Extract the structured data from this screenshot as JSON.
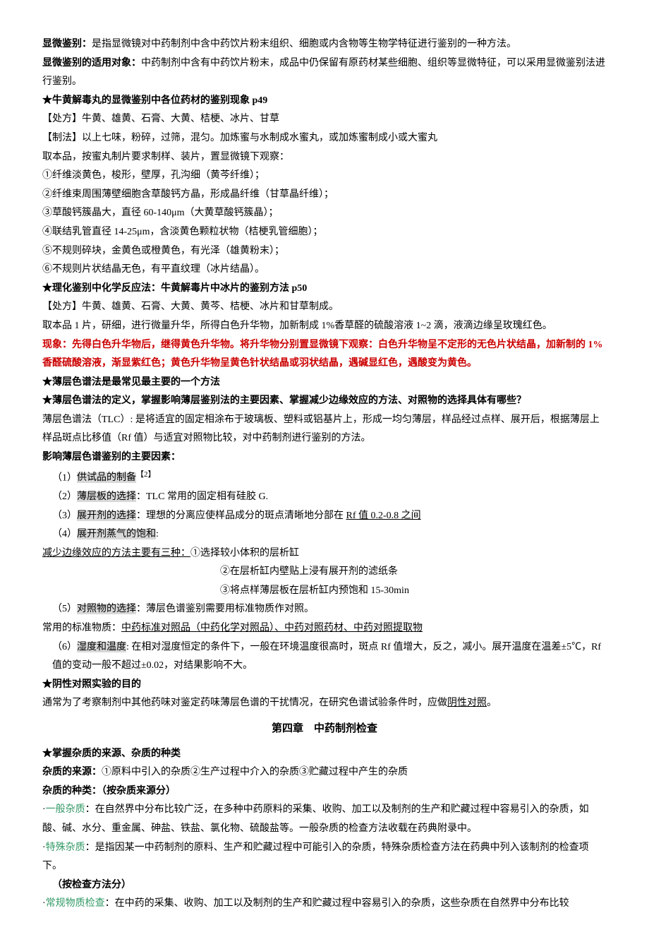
{
  "p01a": "显微鉴别：",
  "p01b": "是指显微镜对中药制剂中含中药饮片粉末组织、细胞或内含物等生物学特征进行鉴别的一种方法。",
  "p02a": "显微鉴别的适用对象：",
  "p02b": "中药制剂中含有中药饮片粉末，成品中仍保留有原药材某些细胞、组织等显微特征，可以采用显微鉴别法进行鉴别。",
  "p03": "★牛黄解毒丸的显微鉴别中各位药材的鉴别现象 p49",
  "p04": "【处方】牛黄、雄黄、石膏、大黄、桔梗、冰片、甘草",
  "p05": "【制法】以上七味，粉碎，过筛，混匀。加炼蜜与水制成水蜜丸，或加炼蜜制成小或大蜜丸",
  "p06": "取本品，按蜜丸制片要求制样、装片，置显微镜下观察：",
  "p07": "①纤维淡黄色，梭形，壁厚，孔沟细（黄芩纤维）；",
  "p08": "②纤维束周围薄壁细胞含草酸钙方晶，形成晶纤维（甘草晶纤维）；",
  "p09": "③草酸钙簇晶大，直径 60-140μm（大黄草酸钙簇晶）；",
  "p10": "④联结乳管直径 14-25μm，含淡黄色颗粒状物（桔梗乳管细胞）；",
  "p11": "⑤不规则碎块，金黄色或橙黄色，有光泽（雄黄粉末）；",
  "p12": "⑥不规则片状结晶无色，有平直纹理（冰片结晶）。",
  "p13": "★理化鉴别中化学反应法：牛黄解毒片中冰片的鉴别方法 p50",
  "p14": "【处方】牛黄、雄黄、石膏、大黄、黄芩、桔梗、冰片和甘草制成。",
  "p15": "取本品 1 片，研细，进行微量升华，所得白色升华物，加新制成 1%香草醛的硫酸溶液 1~2 滴，液滴边缘呈玫瑰红色。",
  "p16": "现象：先得白色升华物后，继得黄色升华物。将升华物分别置显微镜下观察：白色升华物呈不定形的无色片状结晶，加新制的 1%香醛硫酸溶液，渐显紫红色；黄色升华物呈黄色针状结晶或羽状结晶，遇碱显红色，遇酸变为黄色。",
  "p17": "★薄层色谱法是最常见最主要的一个方法",
  "p18": "★薄层色谱法的定义，掌握影响薄层鉴别法的主要因素、掌握减少边缘效应的方法、对照物的选择具体有哪些？",
  "p19": "薄层色谱法（TLC）: 是将适宜的固定相涂布于玻璃板、塑料或铝基片上，形成一均匀薄层，样品经过点样、展开后，根据薄层上样品斑点比移值（Rf 值）与适宜对照物比较，对中药制剂进行鉴别的方法。",
  "p20": "影响薄层色谱鉴别的主要因素：",
  "p21a": "（1）",
  "p21b": "供试品的制备",
  "p21c": "【2】",
  "p22a": "（2）",
  "p22b": "薄层板的选择",
  "p22c": "：TLC 常用的固定相有硅胶 G.",
  "p23a": "（3）",
  "p23b": "展开剂的选择",
  "p23c": "：理想的分离应使样品成分的斑点清晰地分部在 ",
  "p23d": "Rf 值 0.2-0.8 之间",
  "p24a": "（4）",
  "p24b": "展开剂蒸气的饱和",
  "p24c": ":",
  "p25a": "减少边缘效应的方法主要有三种：",
  "p25b": "①选择较小体积的层析缸",
  "p26": "②在层析缸内壁贴上浸有展开剂的滤纸条",
  "p27": "③将点样薄层板在层析缸内预饱和 15-30min",
  "p28a": "（5）",
  "p28b": "对照物的选择",
  "p28c": "：薄层色谱鉴别需要用标准物质作对照。",
  "p29a": "常用的标准物质：",
  "p29b": "中药标准对照品（中药化学对照品）、中药对照药材、中药对照提取物",
  "p30a": "（6）",
  "p30b": "湿度和温度",
  "p30c": ": 在相对湿度恒定的条件下，一般在环境温度很高时，斑点 Rf 值增大，反之，减小。展开温度在温差±5℃，Rf 值的变动一般不超过±0.02，对结果影响不大。",
  "p31": "★阴性对照实验的目的",
  "p32a": "通常为了考察制剂中其他药味对鉴定药味薄层色谱的干扰情况，在研究色谱试验条件时，应做",
  "p32b": "阴性对照",
  "p32c": "。",
  "chapter": "第四章　中药制剂检查",
  "p33": "★掌握杂质的来源、杂质的种类",
  "p34a": "杂质的来源：",
  "p34b": "①原料中引入的杂质②生产过程中介入的杂质③贮藏过程中产生的杂质",
  "p35": "杂质的种类：（按杂质来源分）",
  "p36a": "·",
  "p36b": "一般杂质",
  "p36c": "：在自然界中分布比较广泛，在多种中药原料的采集、收购、加工以及制剂的生产和贮藏过程中容易引入的杂质，如酸、碱、水分、重金属、砷盐、铁盐、氯化物、硫酸盐等。一般杂质的检查方法收载在药典附录中。",
  "p37a": "·",
  "p37b": "特殊杂质",
  "p37c": "：是指因某一中药制剂的原料、生产和贮藏过程中可能引入的杂质，特殊杂质检查方法在药典中列入该制剂的检查项下。",
  "p38": "（按检查方法分）",
  "p39a": "·",
  "p39b": "常规物质检查",
  "p39c": "：在中药的采集、收购、加工以及制剂的生产和贮藏过程中容易引入的杂质，这些杂质在自然界中分布比较"
}
